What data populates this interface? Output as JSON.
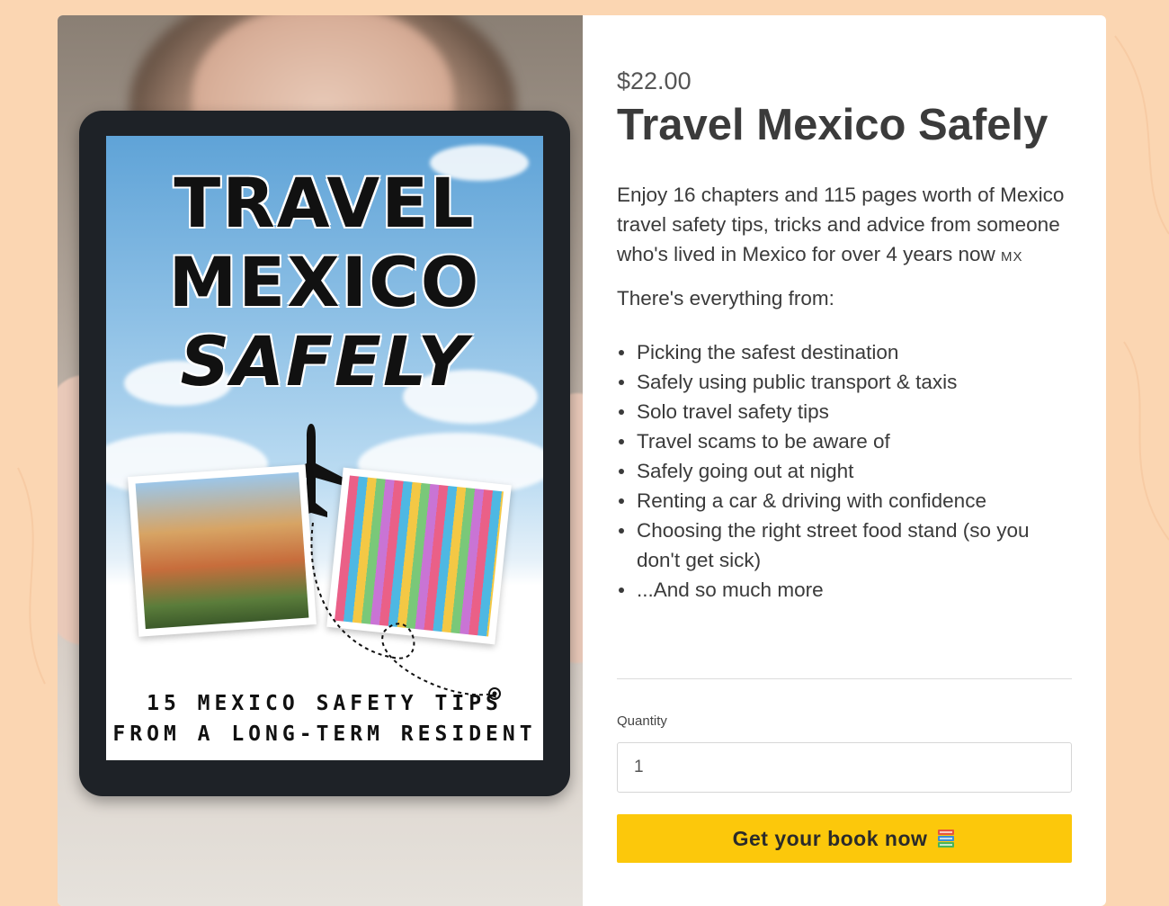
{
  "product": {
    "image": {
      "cover_title_line1": "TRAVEL",
      "cover_title_line2": "MEXICO",
      "cover_title_line3": "SAFELY",
      "cover_subtitle_line1": "15 MEXICO SAFETY TIPS",
      "cover_subtitle_line2": "FROM A LONG-TERM RESIDENT"
    },
    "price": "$22.00",
    "title": "Travel Mexico Safely",
    "description": "Enjoy 16 chapters and 115 pages worth of Mexico travel safety tips, tricks and advice from someone who's lived in Mexico for over 4 years now",
    "description_flag": "MX",
    "intro": "There's everything from:",
    "features": [
      "Picking the safest destination",
      "Safely using public transport & taxis",
      "Solo travel safety tips",
      "Travel scams to be aware of",
      "Safely going out at night",
      "Renting a car & driving with confidence",
      "Choosing the right street food stand (so you don't get sick)",
      "...And so much more"
    ],
    "quantity_label": "Quantity",
    "quantity_value": "1",
    "buy_button_label": "Get your book now",
    "buy_button_icon": "books-icon"
  },
  "colors": {
    "page_background": "#fbd6b2",
    "card_background": "#ffffff",
    "button_accent": "#fcc80b",
    "text": "#3a3a3a"
  }
}
